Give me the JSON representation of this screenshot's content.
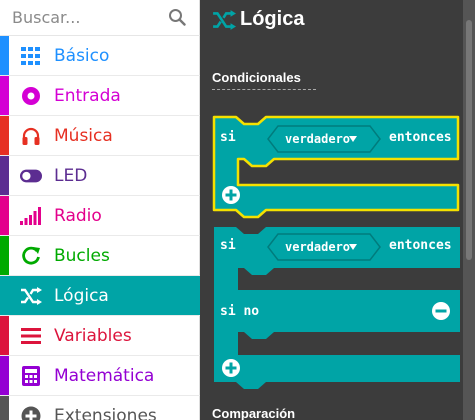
{
  "search": {
    "placeholder": "Buscar..."
  },
  "categories": [
    {
      "label": "Básico",
      "color": "#1e90ff",
      "icon": "grid-icon"
    },
    {
      "label": "Entrada",
      "color": "#d400d4",
      "icon": "radio-target-icon"
    },
    {
      "label": "Música",
      "color": "#e63022",
      "icon": "headphones-icon"
    },
    {
      "label": "LED",
      "color": "#5c2d91",
      "icon": "toggle-icon"
    },
    {
      "label": "Radio",
      "color": "#e3008c",
      "icon": "signal-bars-icon"
    },
    {
      "label": "Bucles",
      "color": "#00aa00",
      "icon": "refresh-icon"
    },
    {
      "label": "Lógica",
      "color": "#00a4a6",
      "icon": "shuffle-icon",
      "selected": true
    },
    {
      "label": "Variables",
      "color": "#dc143c",
      "icon": "list-icon"
    },
    {
      "label": "Matemática",
      "color": "#9400d3",
      "icon": "calculator-icon"
    },
    {
      "label": "Extensiones",
      "color": "#555555",
      "icon": "plus-circle-icon"
    }
  ],
  "flyout": {
    "title": "Lógica",
    "sections": {
      "conditionals": "Condicionales",
      "comparison": "Comparación"
    },
    "block1": {
      "si": "si",
      "value": "verdadero",
      "then": "entonces"
    },
    "block2": {
      "si": "si",
      "value": "verdadero",
      "then": "entonces",
      "else": "si no"
    }
  },
  "colors": {
    "logic": "#00a4a6",
    "highlight": "#f5e100",
    "flyout_bg": "#3c3c3c"
  }
}
